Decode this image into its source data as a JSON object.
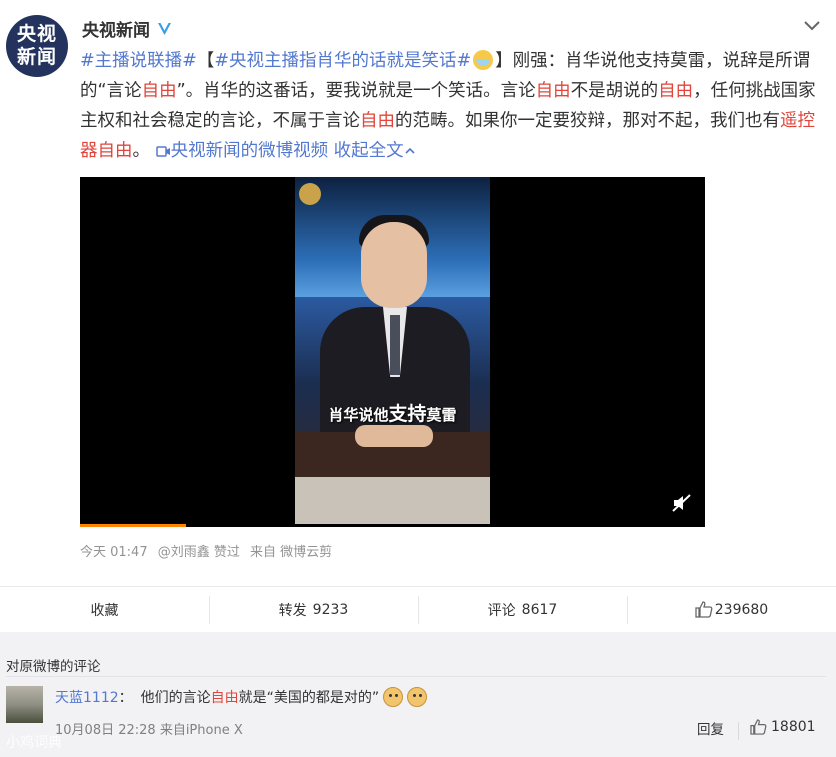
{
  "post": {
    "avatar_text": "央视新闻",
    "author": "央视新闻",
    "text": {
      "topic1": "#主播说联播#",
      "bracket_open": "【",
      "topic2": "#央视主播指肖华的话就是笑话#",
      "emoji_name": "smile-emoji",
      "p1": "】刚强：肖华说他支持莫雷，说辞是所谓的“言论",
      "hl1": "自由",
      "p2": "”。肖华的这番话，要我说就是一个笑话。言论",
      "hl2": "自由",
      "p3": "不是胡说的",
      "hl3": "自由",
      "p4": "，任何挑战国家主权和社会稳定的言论，不属于言论",
      "hl4": "自由",
      "p5": "的范畴。如果你一定要狡辩，那对不起，我们也有",
      "hl5": "遥控器自由",
      "p6": "。",
      "video_link": "央视新闻的微博视频",
      "collapse": "收起全文"
    },
    "video": {
      "caption_small1": "肖华说他",
      "caption_big": "支持",
      "caption_small2": "莫雷",
      "progress": 0.17
    },
    "meta": {
      "time": "今天 01:47",
      "liker": "@刘雨鑫 赞过",
      "source": "来自 微博云剪"
    },
    "actions": {
      "favorite": "收藏",
      "repost_label": "转发",
      "repost_count": "9233",
      "comment_label": "评论",
      "comment_count": "8617",
      "like_count": "239680"
    }
  },
  "comments": {
    "header": "对原微博的评论",
    "items": [
      {
        "user": "天蓝1112",
        "sep": "：",
        "t1": "他们的言论",
        "hl": "自由",
        "t2": "就是“美国的都是对的”",
        "time": "10月08日 22:28 来自iPhone X",
        "reply": "回复",
        "likes": "18801"
      }
    ]
  },
  "watermark": "小鸡词典",
  "colors": {
    "link": "#5378d0",
    "highlight": "#e0463b",
    "progress": "#ff8200"
  }
}
